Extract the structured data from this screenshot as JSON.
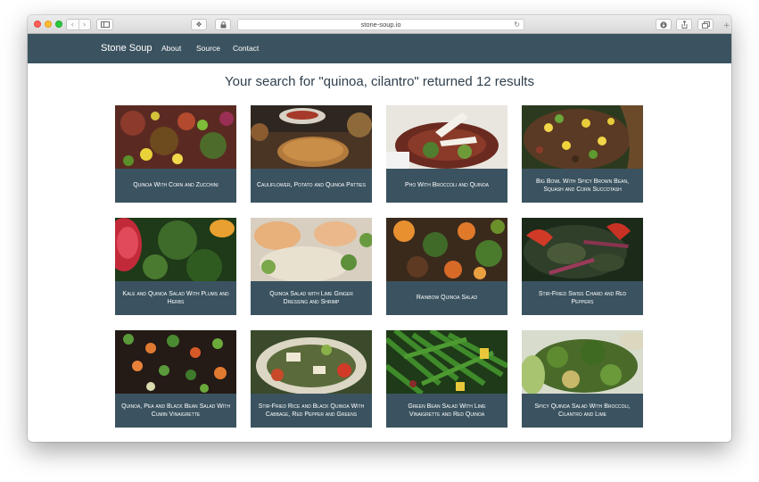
{
  "browser": {
    "url": "stone-soup.io",
    "back_icon": "chevron-left-icon",
    "forward_icon": "chevron-right-icon"
  },
  "nav": {
    "brand": "Stone Soup",
    "links": [
      "About",
      "Source",
      "Contact"
    ]
  },
  "colors": {
    "navbar": "#3b5360",
    "heading": "#2f3f4d",
    "card_caption_bg": "#3b5360"
  },
  "search": {
    "heading": "Your search for \"quinoa, cilantro\" returned 12 results"
  },
  "results": [
    {
      "title": "Quinoa With Corn and Zucchini"
    },
    {
      "title": "Cauliflower, Potato and Quinoa Patties"
    },
    {
      "title": "Pho With Broccoli and Quinoa"
    },
    {
      "title": "Big Bowl With Spicy Brown Bean, Squash and Corn Succotash"
    },
    {
      "title": "Kale and Quinoa Salad With Plums and Herbs"
    },
    {
      "title": "Quinoa Salad with Lime Ginger Dressing and Shrimp"
    },
    {
      "title": "Rainbow Quinoa Salad"
    },
    {
      "title": "Stir-Fried Swiss Chard and Red Peppers"
    },
    {
      "title": "Quinoa, Pea and Black Bean Salad With Cumin Vinaigrette"
    },
    {
      "title": "Stir-Fried Rice and Black Quinoa With Cabbage, Red Pepper and Greens"
    },
    {
      "title": "Green Bean Salad With Lime Vinaigrette and Red Quinoa"
    },
    {
      "title": "Spicy Quinoa Salad With Broccoli, Cilantro and Lime"
    }
  ]
}
